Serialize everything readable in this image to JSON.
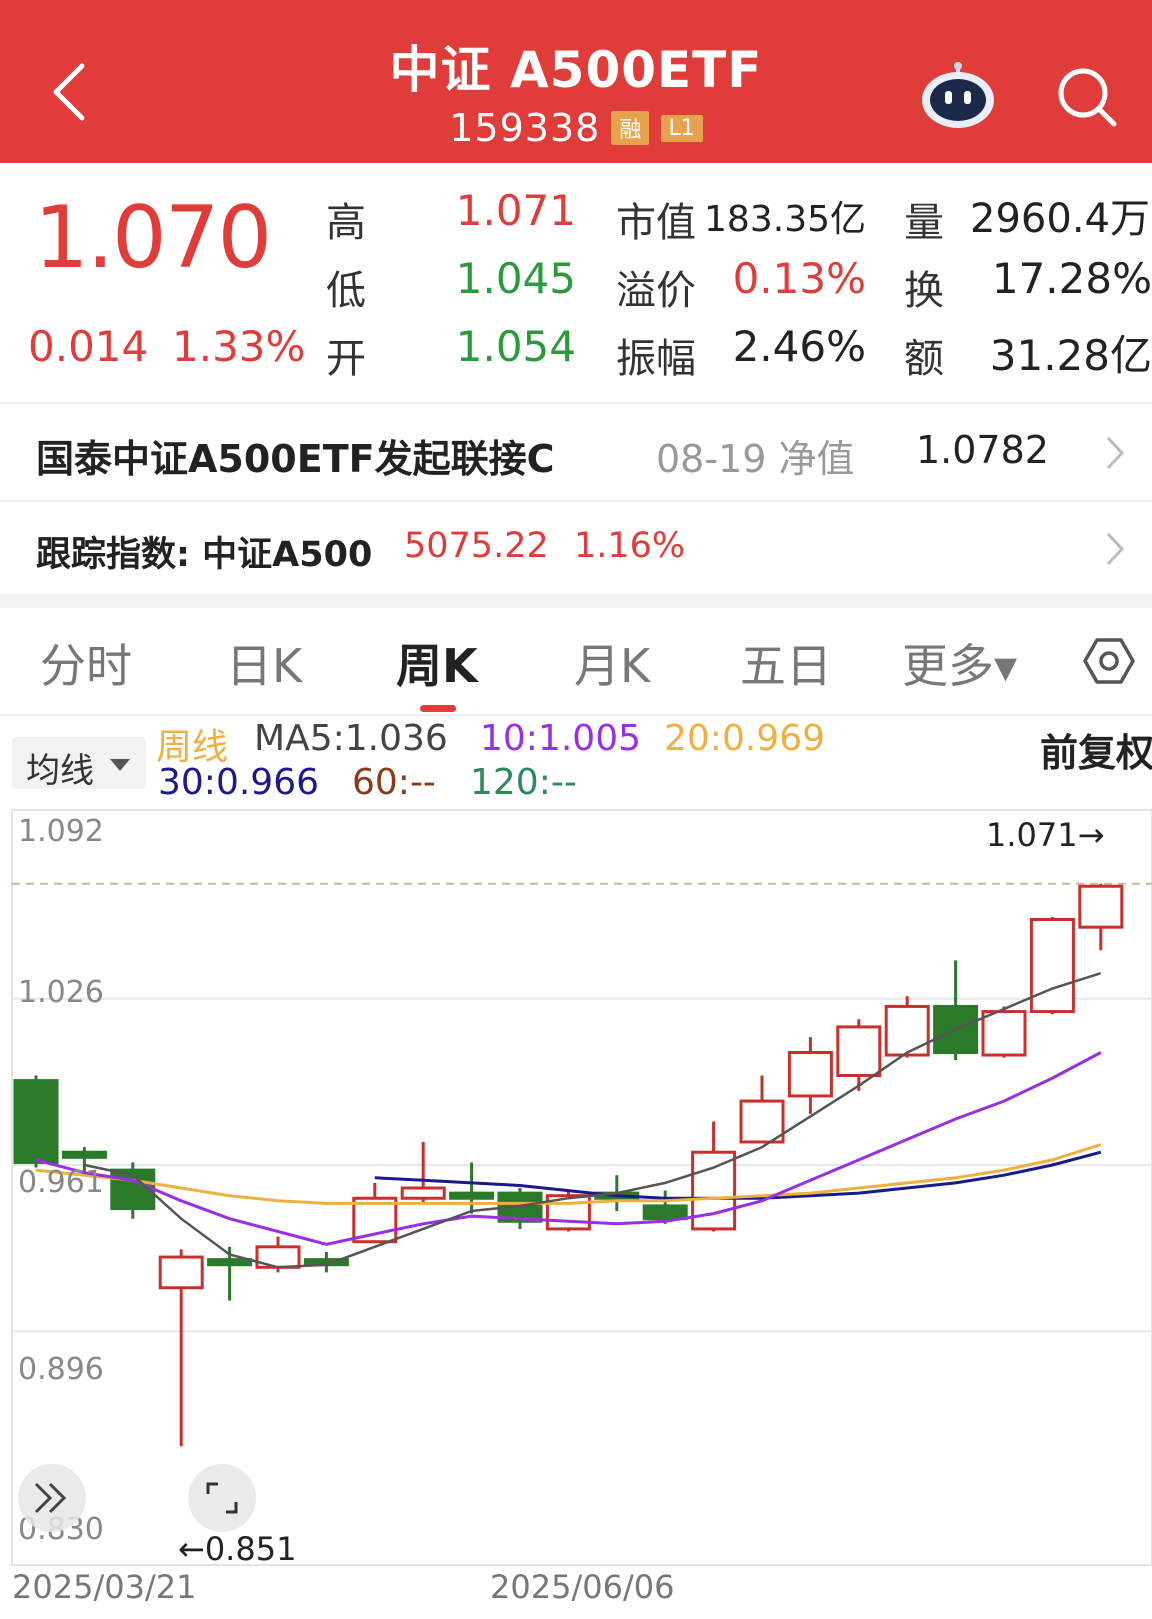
{
  "header": {
    "title": "中证 A500ETF",
    "code": "159338",
    "badges": [
      "融",
      "L1"
    ],
    "bg_color": "#e03c3a"
  },
  "quote": {
    "price": "1.070",
    "change": "0.014",
    "change_pct": "1.33%",
    "fields": [
      {
        "label": "高",
        "value": "1.071",
        "color": "red"
      },
      {
        "label": "低",
        "value": "1.045",
        "color": "green"
      },
      {
        "label": "开",
        "value": "1.054",
        "color": "green"
      },
      {
        "label": "市值",
        "value": "183.35亿",
        "color": "dark"
      },
      {
        "label": "溢价",
        "value": "0.13%",
        "color": "red"
      },
      {
        "label": "振幅",
        "value": "2.46%",
        "color": "dark"
      },
      {
        "label": "量",
        "value": "2960.4万",
        "color": "dark"
      },
      {
        "label": "换",
        "value": "17.28%",
        "color": "dark"
      },
      {
        "label": "额",
        "value": "31.28亿",
        "color": "dark"
      }
    ]
  },
  "linked_fund": {
    "name": "国泰中证A500ETF发起联接C",
    "nav_label": "08-19 净值",
    "nav_value": "1.0782"
  },
  "tracking_index": {
    "label": "跟踪指数: 中证A500",
    "value": "5075.22",
    "pct": "1.16%"
  },
  "tabs": [
    "分时",
    "日K",
    "周K",
    "月K",
    "五日",
    "更多▾"
  ],
  "active_tab": "周K",
  "ma_legend": {
    "button": "均线",
    "period": "周线",
    "ma5": "MA5:1.036",
    "ma10": "10:1.005",
    "ma20": "20:0.969",
    "ma30": "30:0.966",
    "ma60": "60:--",
    "ma120": "120:--",
    "adjust": "前复权"
  },
  "chart_data": {
    "type": "candlestick",
    "y_ticks": [
      "1.092",
      "1.026",
      "0.961",
      "0.896",
      "0.830"
    ],
    "ylim": [
      0.83,
      1.092
    ],
    "x_ticks": [
      "2025/03/21",
      "2025/06/06"
    ],
    "high_marker": "1.071→",
    "low_marker": "←0.851",
    "high_value": 1.071,
    "low_value": 0.851,
    "candles": [
      {
        "o": 0.994,
        "c": 0.962,
        "h": 0.996,
        "l": 0.96
      },
      {
        "o": 0.966,
        "c": 0.964,
        "h": 0.968,
        "l": 0.958
      },
      {
        "o": 0.959,
        "c": 0.944,
        "h": 0.962,
        "l": 0.94
      },
      {
        "o": 0.913,
        "c": 0.925,
        "h": 0.928,
        "l": 0.851
      },
      {
        "o": 0.924,
        "c": 0.922,
        "h": 0.929,
        "l": 0.908
      },
      {
        "o": 0.921,
        "c": 0.929,
        "h": 0.933,
        "l": 0.919
      },
      {
        "o": 0.924,
        "c": 0.922,
        "h": 0.927,
        "l": 0.919
      },
      {
        "o": 0.931,
        "c": 0.948,
        "h": 0.954,
        "l": 0.931
      },
      {
        "o": 0.948,
        "c": 0.952,
        "h": 0.97,
        "l": 0.946
      },
      {
        "o": 0.95,
        "c": 0.948,
        "h": 0.962,
        "l": 0.942
      },
      {
        "o": 0.95,
        "c": 0.939,
        "h": 0.952,
        "l": 0.936
      },
      {
        "o": 0.936,
        "c": 0.949,
        "h": 0.951,
        "l": 0.935
      },
      {
        "o": 0.95,
        "c": 0.948,
        "h": 0.957,
        "l": 0.943
      },
      {
        "o": 0.945,
        "c": 0.94,
        "h": 0.951,
        "l": 0.938
      },
      {
        "o": 0.936,
        "c": 0.966,
        "h": 0.978,
        "l": 0.935
      },
      {
        "o": 0.97,
        "c": 0.986,
        "h": 0.996,
        "l": 0.97
      },
      {
        "o": 0.988,
        "c": 1.005,
        "h": 1.011,
        "l": 0.981
      },
      {
        "o": 0.996,
        "c": 1.015,
        "h": 1.018,
        "l": 0.99
      },
      {
        "o": 1.004,
        "c": 1.023,
        "h": 1.027,
        "l": 1.003
      },
      {
        "o": 1.023,
        "c": 1.005,
        "h": 1.041,
        "l": 1.002
      },
      {
        "o": 1.004,
        "c": 1.021,
        "h": 1.023,
        "l": 1.003
      },
      {
        "o": 1.021,
        "c": 1.057,
        "h": 1.058,
        "l": 1.02
      },
      {
        "o": 1.054,
        "c": 1.07,
        "h": 1.071,
        "l": 1.045
      }
    ],
    "ma5": [
      null,
      0.961,
      0.957,
      0.94,
      0.926,
      0.921,
      0.922,
      0.929,
      0.936,
      0.943,
      0.945,
      0.948,
      0.95,
      0.954,
      0.96,
      0.968,
      0.98,
      0.992,
      1.005,
      1.014,
      1.022,
      1.03,
      1.036
    ],
    "ma10": [
      0.963,
      0.958,
      0.955,
      0.947,
      0.94,
      0.935,
      0.93,
      0.934,
      0.938,
      0.941,
      0.94,
      0.939,
      0.938,
      0.939,
      0.942,
      0.947,
      0.955,
      0.963,
      0.971,
      0.979,
      0.986,
      0.995,
      1.005
    ],
    "ma20": [
      0.959,
      0.957,
      0.955,
      0.952,
      0.949,
      0.947,
      0.946,
      0.946,
      0.946,
      0.946,
      0.946,
      0.946,
      0.947,
      0.947,
      0.948,
      0.949,
      0.95,
      0.952,
      0.954,
      0.956,
      0.959,
      0.963,
      0.969
    ],
    "ma30": [
      null,
      null,
      null,
      null,
      null,
      null,
      null,
      0.956,
      0.955,
      0.954,
      0.953,
      0.951,
      0.949,
      0.948,
      0.948,
      0.948,
      0.949,
      0.95,
      0.952,
      0.954,
      0.957,
      0.961,
      0.966
    ],
    "colors": {
      "up": "#c8302c",
      "down": "#2a7a2a",
      "ma5": "#555555",
      "ma10": "#9a2ee6",
      "ma20": "#f0b040",
      "ma30": "#1a1a8c"
    }
  }
}
